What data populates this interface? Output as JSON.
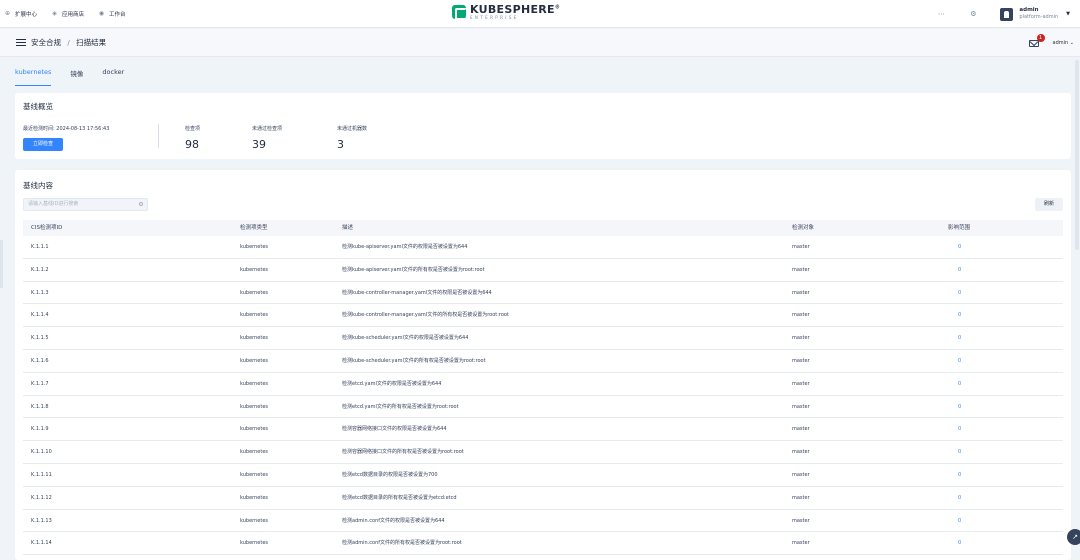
{
  "topnav": {
    "items": [
      {
        "icon": "expand-icon",
        "label": "扩展中心"
      },
      {
        "icon": "store-icon",
        "label": "应用商店"
      },
      {
        "icon": "workbench-icon",
        "label": "工作台"
      }
    ]
  },
  "brand": {
    "name": "KUBESPHERE",
    "edition": "ENTERPRISE",
    "mark": "®"
  },
  "user": {
    "name": "admin",
    "role": "platform-admin"
  },
  "header": {
    "breadcrumb": [
      "安全合规",
      "扫描结果"
    ],
    "separator": "/",
    "notification_count": "1",
    "user_menu": "admin"
  },
  "tabs": [
    {
      "label": "kubernetes",
      "active": true
    },
    {
      "label": "镜像",
      "active": false
    },
    {
      "label": "docker",
      "active": false
    }
  ],
  "overview": {
    "title": "基线概览",
    "last_scan_label": "最近检测时间:",
    "last_scan_time": "2024-08-13 17:56:43",
    "scan_button": "立即检查",
    "stats": [
      {
        "label": "检查项",
        "value": "98"
      },
      {
        "label": "未通过检查项",
        "value": "39"
      },
      {
        "label": "未通过机器数",
        "value": "3"
      }
    ]
  },
  "content": {
    "title": "基线内容",
    "search_placeholder": "请输入基线ID进行搜索",
    "refresh_button": "刷新",
    "columns": [
      "CIS检测项ID",
      "检测项类型",
      "描述",
      "检测对象",
      "影响范围"
    ],
    "rows": [
      {
        "id": "K.1.1.1",
        "type": "kubernetes",
        "desc": "检测kube-apiserver.yaml文件的权限是否被设置为644",
        "target": "master",
        "scope": "0"
      },
      {
        "id": "K.1.1.2",
        "type": "kubernetes",
        "desc": "检测kube-apiserver.yaml文件的所有权是否被设置为root:root",
        "target": "master",
        "scope": "0"
      },
      {
        "id": "K.1.1.3",
        "type": "kubernetes",
        "desc": "检测kube-controller-manager.yaml文件的权限是否被设置为644",
        "target": "master",
        "scope": "0"
      },
      {
        "id": "K.1.1.4",
        "type": "kubernetes",
        "desc": "检测kube-controller-manager.yaml文件的所有权是否被设置为root:root",
        "target": "master",
        "scope": "0"
      },
      {
        "id": "K.1.1.5",
        "type": "kubernetes",
        "desc": "检测kube-scheduler.yaml文件的权限是否被设置为644",
        "target": "master",
        "scope": "0"
      },
      {
        "id": "K.1.1.6",
        "type": "kubernetes",
        "desc": "检测kube-scheduler.yaml文件的所有权是否被设置为root:root",
        "target": "master",
        "scope": "0"
      },
      {
        "id": "K.1.1.7",
        "type": "kubernetes",
        "desc": "检测etcd.yaml文件的权限是否被设置为644",
        "target": "master",
        "scope": "0"
      },
      {
        "id": "K.1.1.8",
        "type": "kubernetes",
        "desc": "检测etcd.yaml文件的所有权是否被设置为root:root",
        "target": "master",
        "scope": "0"
      },
      {
        "id": "K.1.1.9",
        "type": "kubernetes",
        "desc": "检测容器网络接口文件的权限是否被设置为644",
        "target": "master",
        "scope": "0"
      },
      {
        "id": "K.1.1.10",
        "type": "kubernetes",
        "desc": "检测容器网络接口文件的所有权是否被设置为root:root",
        "target": "master",
        "scope": "0"
      },
      {
        "id": "K.1.1.11",
        "type": "kubernetes",
        "desc": "检测etcd数据目录的权限是否被设置为700",
        "target": "master",
        "scope": "0"
      },
      {
        "id": "K.1.1.12",
        "type": "kubernetes",
        "desc": "检测etcd数据目录的所有权是否被设置为etcd:etcd",
        "target": "master",
        "scope": "0"
      },
      {
        "id": "K.1.1.13",
        "type": "kubernetes",
        "desc": "检测admin.conf文件的权限是否被设置为644",
        "target": "master",
        "scope": "0"
      },
      {
        "id": "K.1.1.14",
        "type": "kubernetes",
        "desc": "检测admin.conf文件的所有权是否被设置为root:root",
        "target": "master",
        "scope": "0"
      }
    ]
  },
  "colors": {
    "accent": "#3385ff",
    "brand": "#00aa72",
    "badge": "#ca2621",
    "text": "#242e42"
  }
}
